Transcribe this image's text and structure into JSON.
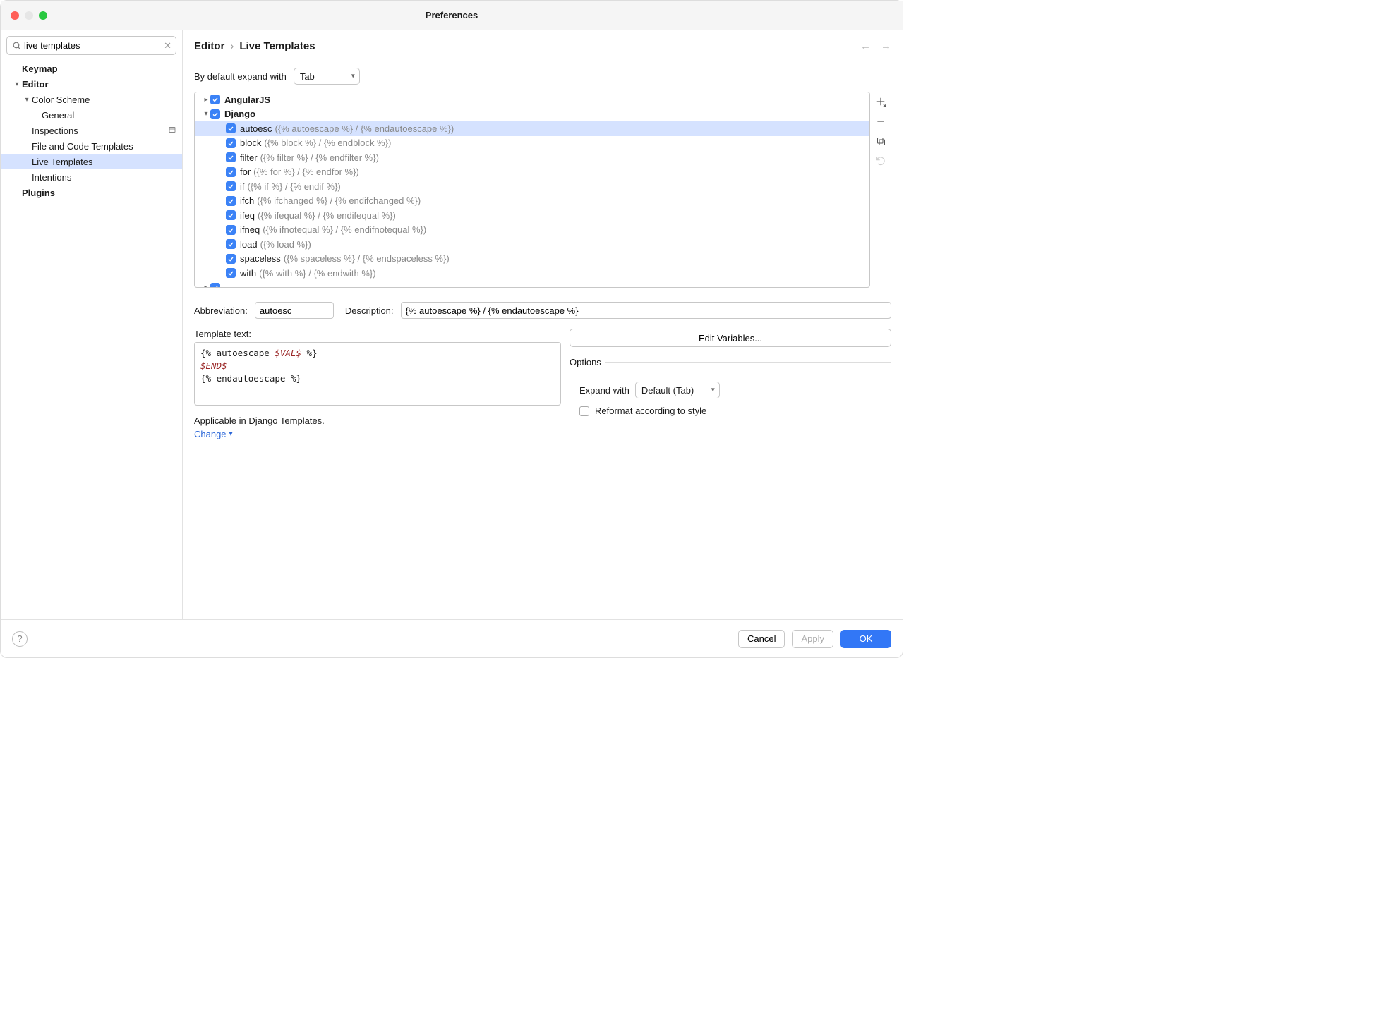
{
  "window": {
    "title": "Preferences"
  },
  "search": {
    "value": "live templates"
  },
  "sidebar": {
    "items": [
      {
        "label": "Keymap",
        "bold": true,
        "indent": 30,
        "chev": ""
      },
      {
        "label": "Editor",
        "bold": true,
        "indent": 30,
        "chev": "▾"
      },
      {
        "label": "Color Scheme",
        "bold": false,
        "indent": 44,
        "chev": "▾"
      },
      {
        "label": "General",
        "bold": false,
        "indent": 58,
        "chev": ""
      },
      {
        "label": "Inspections",
        "bold": false,
        "indent": 44,
        "chev": "",
        "gutter": true
      },
      {
        "label": "File and Code Templates",
        "bold": false,
        "indent": 44,
        "chev": ""
      },
      {
        "label": "Live Templates",
        "bold": false,
        "indent": 44,
        "chev": "",
        "selected": true
      },
      {
        "label": "Intentions",
        "bold": false,
        "indent": 44,
        "chev": ""
      },
      {
        "label": "Plugins",
        "bold": true,
        "indent": 30,
        "chev": ""
      }
    ]
  },
  "breadcrumb": {
    "a": "Editor",
    "sep": "›",
    "b": "Live Templates"
  },
  "expand": {
    "label": "By default expand with",
    "value": "Tab"
  },
  "templates": {
    "groups": [
      {
        "name": "AngularJS",
        "expanded": false,
        "items": []
      },
      {
        "name": "Django",
        "expanded": true,
        "items": [
          {
            "abbr": "autoesc",
            "desc": "({% autoescape %} / {% endautoescape %})",
            "selected": true
          },
          {
            "abbr": "block",
            "desc": "({% block %} / {% endblock %})"
          },
          {
            "abbr": "filter",
            "desc": "({% filter %} / {% endfilter %})"
          },
          {
            "abbr": "for",
            "desc": "({% for %} / {% endfor %})"
          },
          {
            "abbr": "if",
            "desc": "({% if %} / {% endif %})"
          },
          {
            "abbr": "ifch",
            "desc": "({% ifchanged %} / {% endifchanged %})"
          },
          {
            "abbr": "ifeq",
            "desc": "({% ifequal %} / {% endifequal %})"
          },
          {
            "abbr": "ifneq",
            "desc": "({% ifnotequal %} / {% endifnotequal %})"
          },
          {
            "abbr": "load",
            "desc": "({% load %})"
          },
          {
            "abbr": "spaceless",
            "desc": "({% spaceless %} / {% endspaceless %})"
          },
          {
            "abbr": "with",
            "desc": "({% with %} / {% endwith %})"
          }
        ]
      }
    ]
  },
  "form": {
    "abbr_label": "Abbreviation:",
    "abbr_value": "autoesc",
    "desc_label": "Description:",
    "desc_value": "{% autoescape %} / {% endautoescape %}",
    "tpl_label": "Template text:",
    "tpl_line1a": "{% autoescape ",
    "tpl_line1b": "$VAL$",
    "tpl_line1c": " %}",
    "tpl_line2": "$END$",
    "tpl_line3": "{% endautoescape %}",
    "edit_vars": "Edit Variables...",
    "options_legend": "Options",
    "expand_label": "Expand with",
    "expand_value": "Default (Tab)",
    "reformat_label": "Reformat according to style",
    "applicable": "Applicable in Django Templates.",
    "change": "Change"
  },
  "footer": {
    "cancel": "Cancel",
    "apply": "Apply",
    "ok": "OK"
  }
}
